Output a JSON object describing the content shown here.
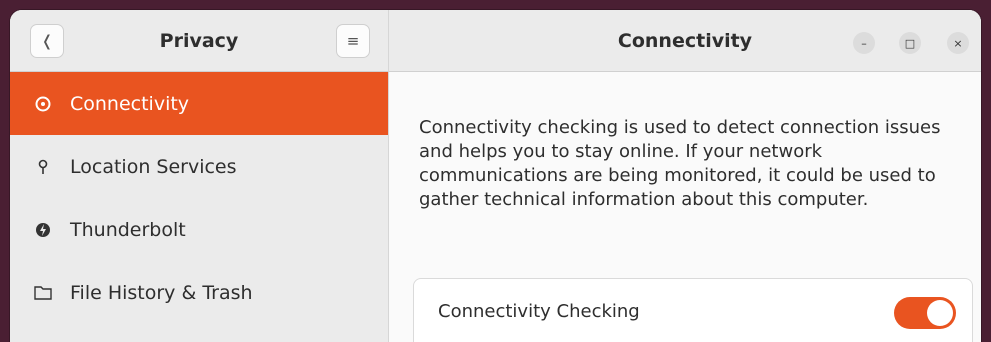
{
  "sidebar": {
    "title": "Privacy",
    "back_icon": "chevron-left-icon",
    "menu_icon": "hamburger-menu-icon",
    "items": [
      {
        "label": "Connectivity",
        "icon": "connectivity-icon",
        "active": true
      },
      {
        "label": "Location Services",
        "icon": "location-pin-icon",
        "active": false
      },
      {
        "label": "Thunderbolt",
        "icon": "thunderbolt-icon",
        "active": false
      },
      {
        "label": "File History & Trash",
        "icon": "folder-icon",
        "active": false
      }
    ]
  },
  "main": {
    "title": "Connectivity",
    "window_controls": {
      "minimize": "–",
      "maximize": "□",
      "close": "×"
    },
    "description": "Connectivity checking is used to detect connection issues and helps you to stay online. If your network communications are being monitored, it could be used to gather technical information about this computer.",
    "setting": {
      "label": "Connectivity Checking",
      "enabled": true
    }
  },
  "colors": {
    "accent": "#e95420",
    "sidebar_bg": "#ebebeb",
    "content_bg": "#fafafa"
  }
}
